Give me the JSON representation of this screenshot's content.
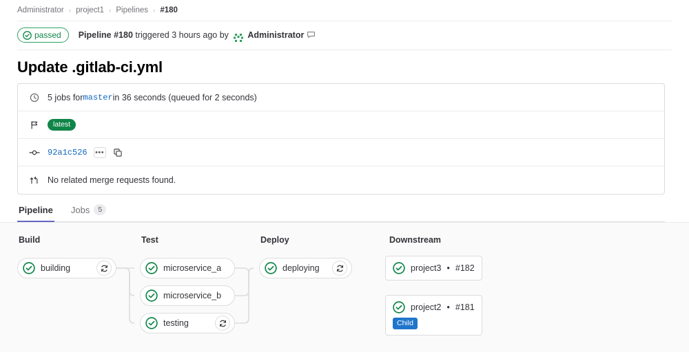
{
  "breadcrumb": {
    "items": [
      {
        "label": "Administrator"
      },
      {
        "label": "project1"
      },
      {
        "label": "Pipelines"
      },
      {
        "label": "#180"
      }
    ],
    "separator": "›"
  },
  "status_header": {
    "badge_label": "passed",
    "badge_icon": "status-success-icon",
    "pipeline_label": "Pipeline #180",
    "triggered_text": " triggered 3 hours ago by ",
    "user_name": "Administrator",
    "avatar_icon": "identicon-avatar",
    "comment_icon": "comment-icon"
  },
  "page_title": "Update .gitlab-ci.yml",
  "info_card": {
    "rows": [
      {
        "icon": "clock-icon",
        "prefix": "5 jobs for ",
        "ref": "master",
        "suffix": " in 36 seconds (queued for 2 seconds)"
      },
      {
        "icon": "flag-icon",
        "badge": "latest"
      },
      {
        "icon": "commit-icon",
        "sha": "92a1c526",
        "ellipsis_label": "•••",
        "copy_icon": "copy-icon"
      },
      {
        "icon": "merge-request-icon",
        "text": "No related merge requests found."
      }
    ]
  },
  "tabs": [
    {
      "label": "Pipeline",
      "active": true,
      "badge": ""
    },
    {
      "label": "Jobs",
      "active": false,
      "badge": "5"
    }
  ],
  "pipeline": {
    "stages": [
      {
        "name": "Build",
        "jobs": [
          {
            "label": "building",
            "status": "success",
            "retry": true
          }
        ]
      },
      {
        "name": "Test",
        "jobs": [
          {
            "label": "microservice_a",
            "status": "success",
            "retry": false
          },
          {
            "label": "microservice_b",
            "status": "success",
            "retry": false
          },
          {
            "label": "testing",
            "status": "success",
            "retry": true
          }
        ]
      },
      {
        "name": "Deploy",
        "jobs": [
          {
            "label": "deploying",
            "status": "success",
            "retry": true
          }
        ]
      },
      {
        "name": "Downstream",
        "cards": [
          {
            "project": "project3",
            "sep": "•",
            "pipeline": "#182",
            "status": "success",
            "badge": ""
          },
          {
            "project": "project2",
            "sep": "•",
            "pipeline": "#181",
            "status": "success",
            "badge": "Child"
          }
        ]
      }
    ]
  },
  "colors": {
    "success_green": "#108548",
    "badge_green": "#108548",
    "link_blue": "#1068bf",
    "child_blue": "#1f75cb",
    "tab_active": "#6666c4",
    "graph_bg": "#fafafa",
    "border": "#dcdcde"
  }
}
